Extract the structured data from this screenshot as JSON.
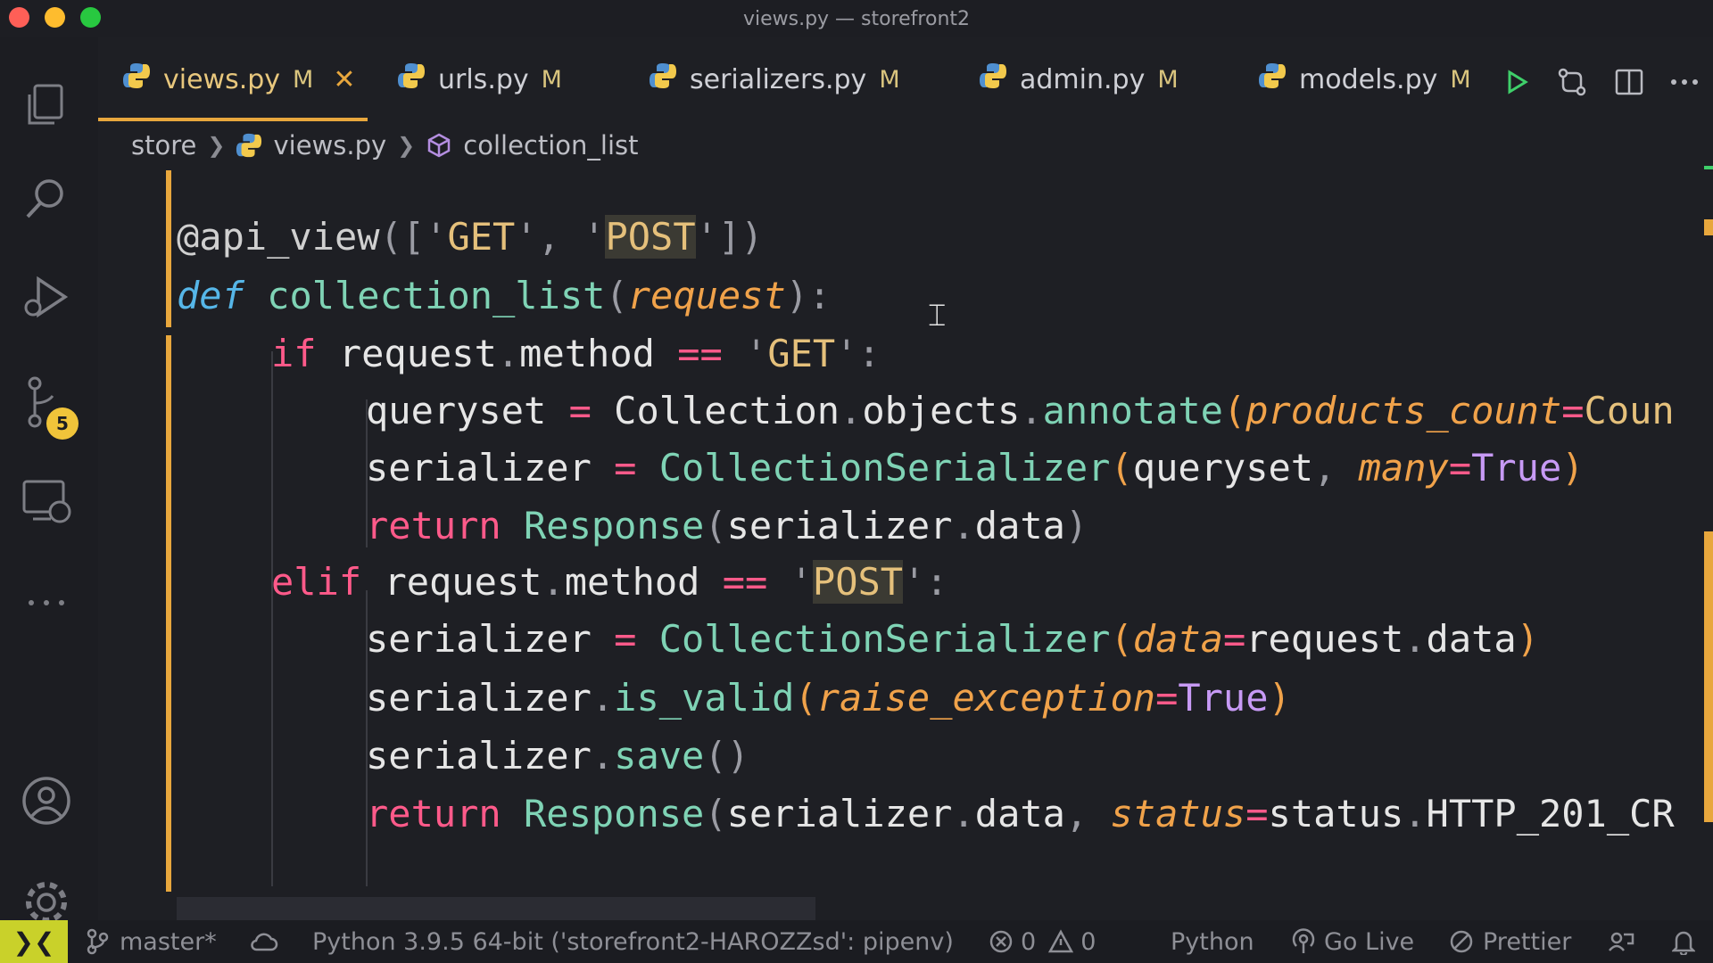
{
  "window": {
    "title": "views.py — storefront2"
  },
  "colors": {
    "accent": "#e8a73d",
    "badge": "#f0c43a",
    "remote": "#c9d12a"
  },
  "activity_bar": {
    "items": [
      "explorer-icon",
      "search-icon",
      "run-debug-icon",
      "source-control-icon",
      "remote-explorer-icon",
      "more-icon",
      "account-icon",
      "settings-gear-icon"
    ],
    "source_control_badge": "5"
  },
  "tabs": [
    {
      "label": "views.py",
      "status": "M",
      "active": true
    },
    {
      "label": "urls.py",
      "status": "M"
    },
    {
      "label": "serializers.py",
      "status": "M"
    },
    {
      "label": "admin.py",
      "status": "M"
    },
    {
      "label": "models.py",
      "status": "M"
    }
  ],
  "tab_close": "✕",
  "toolbar": [
    "run-icon",
    "compare-changes-icon",
    "split-editor-icon",
    "more-actions-icon"
  ],
  "breadcrumb": {
    "folder": "store",
    "file": "views.py",
    "symbol": "collection_list"
  },
  "code": {
    "l1": [
      "@api_view",
      "([",
      "'",
      "GET",
      "'",
      ", ",
      "'",
      "POST",
      "'",
      "])"
    ],
    "l2": [
      "def",
      " ",
      "collection_list",
      "(",
      "request",
      "):"
    ],
    "l3": [
      "if",
      " request",
      ".",
      "method ",
      "==",
      " '",
      "GET",
      "':"
    ],
    "l4": [
      "queryset ",
      "=",
      " Collection",
      ".",
      "objects",
      ".",
      "annotate",
      "(",
      "products_count",
      "=",
      "Coun"
    ],
    "l5": [
      "serializer ",
      "=",
      " ",
      "CollectionSerializer",
      "(",
      "queryset",
      ", ",
      "many",
      "=",
      "True",
      ")"
    ],
    "l6": [
      "return",
      " ",
      "Response",
      "(",
      "serializer",
      ".",
      "data",
      ")"
    ],
    "l7": [
      "elif",
      " request",
      ".",
      "method ",
      "==",
      " '",
      "POST",
      "':"
    ],
    "l8": [
      "serializer ",
      "=",
      " ",
      "CollectionSerializer",
      "(",
      "data",
      "=",
      "request",
      ".",
      "data",
      ")"
    ],
    "l9": [
      "serializer",
      ".",
      "is_valid",
      "(",
      "raise_exception",
      "=",
      "True",
      ")"
    ],
    "l10": [
      "serializer",
      ".",
      "save",
      "()"
    ],
    "l11": [
      "return",
      " ",
      "Response",
      "(",
      "serializer",
      ".",
      "data",
      ", ",
      "status",
      "=",
      "status",
      ".",
      "HTTP_201_CR"
    ]
  },
  "statusbar": {
    "branch": "master*",
    "interpreter": "Python 3.9.5 64-bit ('storefront2-HAROZZsd': pipenv)",
    "errors": "0",
    "warnings": "0",
    "language": "Python",
    "go_live": "Go Live",
    "prettier": "Prettier"
  }
}
